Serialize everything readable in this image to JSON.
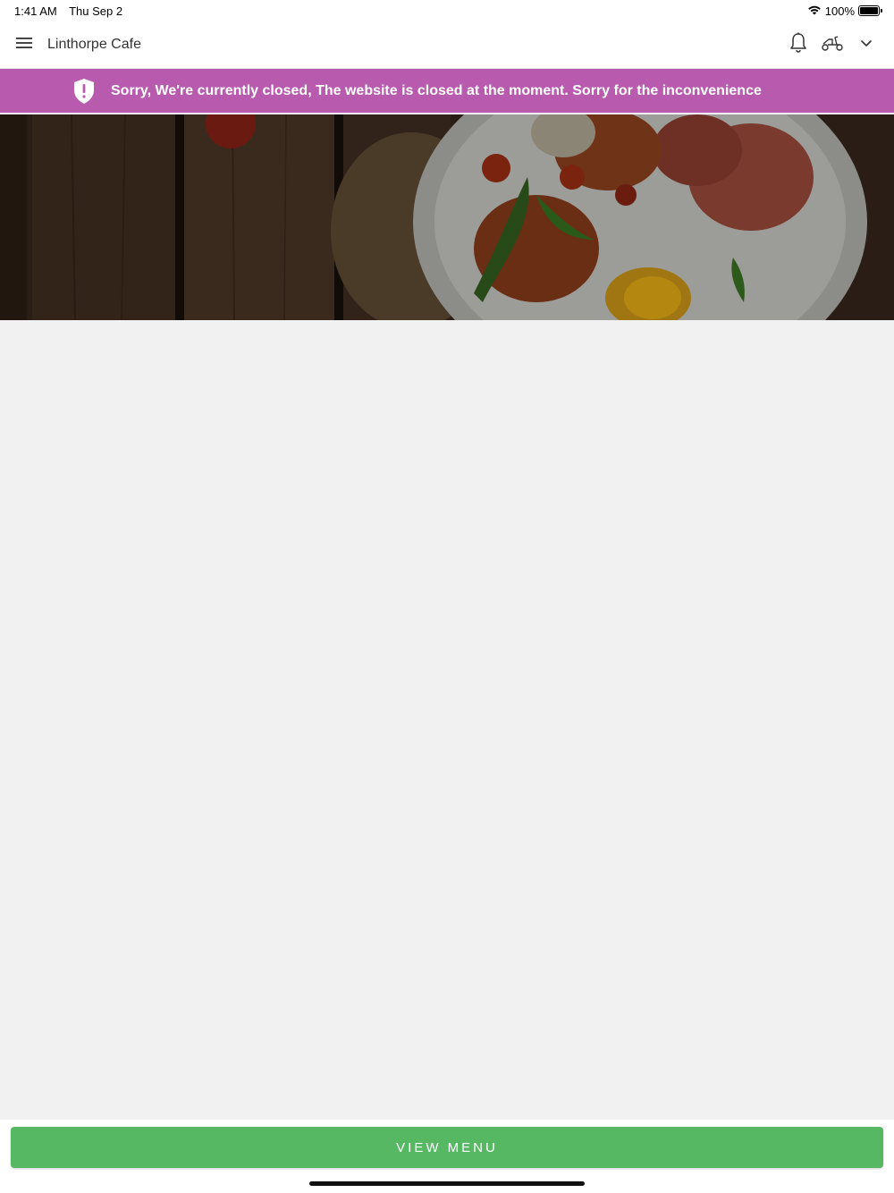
{
  "status_bar": {
    "time": "1:41 AM",
    "date": "Thu Sep 2",
    "battery": "100%",
    "battery_level": 1.0
  },
  "header": {
    "title": "Linthorpe Cafe",
    "menu_icon": "hamburger-icon",
    "notification_icon": "bell-icon",
    "order_mode_icon": "scooter-icon",
    "dropdown_icon": "chevron-down-icon"
  },
  "banner": {
    "icon": "shield-alert-icon",
    "message": "Sorry, We're currently closed, The website is closed at the moment. Sorry for the inconvenience",
    "color": "#b85aae"
  },
  "hero": {
    "image": "breakfast-plate-photo"
  },
  "footer": {
    "view_menu_label": "VIEW MENU",
    "button_color": "#56b862"
  }
}
